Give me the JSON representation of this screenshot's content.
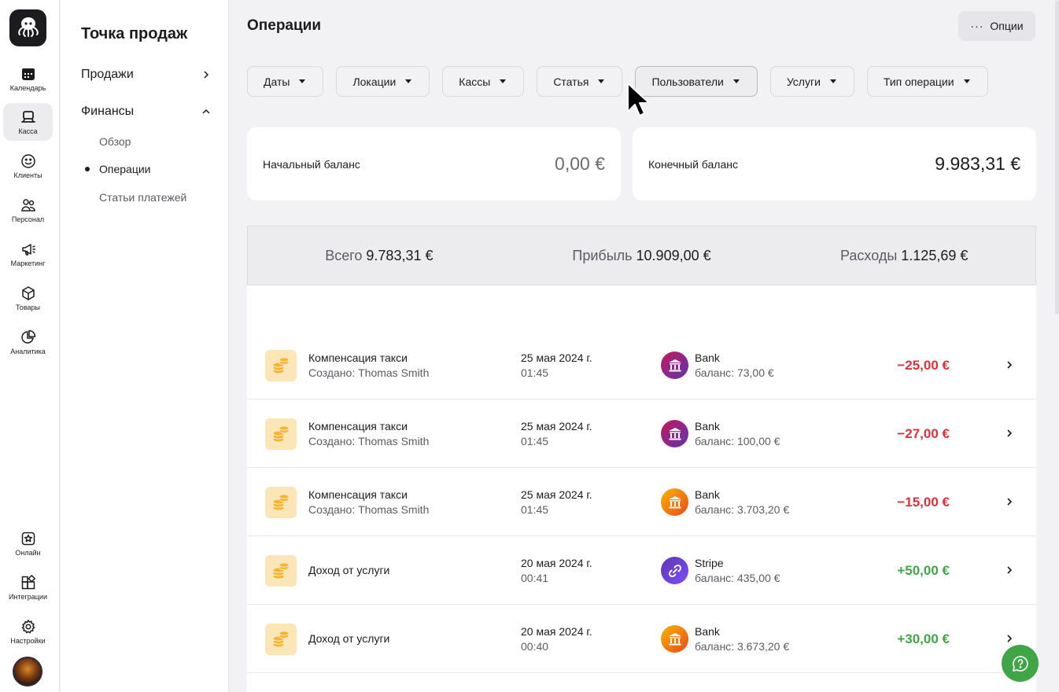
{
  "rail": {
    "items": [
      {
        "label": "Календарь",
        "icon": "calendar-icon"
      },
      {
        "label": "Касса",
        "icon": "register-icon",
        "active": true
      },
      {
        "label": "Клиенты",
        "icon": "smile-icon"
      },
      {
        "label": "Персонал",
        "icon": "staff-icon"
      },
      {
        "label": "Маркетинг",
        "icon": "megaphone-icon"
      },
      {
        "label": "Товары",
        "icon": "box-icon"
      },
      {
        "label": "Аналитика",
        "icon": "pie-icon"
      },
      {
        "label": "Онлайн",
        "icon": "star-icon"
      },
      {
        "label": "Интеграции",
        "icon": "puzzle-icon"
      },
      {
        "label": "Настройки",
        "icon": "gear-icon"
      }
    ]
  },
  "subnav": {
    "title": "Точка продаж",
    "sections": [
      {
        "label": "Продажи",
        "expanded": false
      },
      {
        "label": "Финансы",
        "expanded": true
      }
    ],
    "sub_items": [
      {
        "label": "Обзор"
      },
      {
        "label": "Операции",
        "active": true
      },
      {
        "label": "Статьи платежей"
      }
    ]
  },
  "main": {
    "title": "Операции",
    "options_label": "Опции",
    "filters": [
      "Даты",
      "Локации",
      "Кассы",
      "Статья",
      "Пользователи",
      "Услуги",
      "Тип операции"
    ],
    "opening_balance": {
      "label": "Начальный баланс",
      "value": "0,00 €"
    },
    "closing_balance": {
      "label": "Конечный баланс",
      "value": "9.983,31 €"
    },
    "summary": {
      "total_label": "Всего",
      "total_value": "9.783,31 €",
      "profit_label": "Прибыль",
      "profit_value": "10.909,00 €",
      "expense_label": "Расходы",
      "expense_value": "1.125,69 €"
    },
    "operations": [
      {
        "title": "Компенсация такси",
        "subtitle": "Создано: Thomas Smith",
        "date": "25 мая 2024 г.",
        "time": "01:45",
        "account": "Bank",
        "account_balance": "баланс: 73,00 €",
        "amount": "−25,00 €",
        "kind": "neg",
        "account_icon": "bank-icon",
        "account_color": "purple"
      },
      {
        "title": "Компенсация такси",
        "subtitle": "Создано: Thomas Smith",
        "date": "25 мая 2024 г.",
        "time": "01:45",
        "account": "Bank",
        "account_balance": "баланс: 100,00 €",
        "amount": "−27,00 €",
        "kind": "neg",
        "account_icon": "bank-icon",
        "account_color": "purple"
      },
      {
        "title": "Компенсация такси",
        "subtitle": "Создано: Thomas Smith",
        "date": "25 мая 2024 г.",
        "time": "01:45",
        "account": "Bank",
        "account_balance": "баланс: 3.703,20 €",
        "amount": "−15,00 €",
        "kind": "neg",
        "account_icon": "bank-icon",
        "account_color": "orange"
      },
      {
        "title": "Доход от услуги",
        "subtitle": "",
        "date": "20 мая 2024 г.",
        "time": "00:41",
        "account": "Stripe",
        "account_balance": "баланс: 435,00 €",
        "amount": "+50,00 €",
        "kind": "pos",
        "account_icon": "link-icon",
        "account_color": "violet"
      },
      {
        "title": "Доход от услуги",
        "subtitle": "",
        "date": "20 мая 2024 г.",
        "time": "00:40",
        "account": "Bank",
        "account_balance": "баланс: 3.673,20 €",
        "amount": "+30,00 €",
        "kind": "pos",
        "account_icon": "bank-icon",
        "account_color": "orange"
      }
    ]
  },
  "colors": {
    "negative": "#d8333a",
    "positive": "#3fa547",
    "help_button": "#3fa547"
  }
}
